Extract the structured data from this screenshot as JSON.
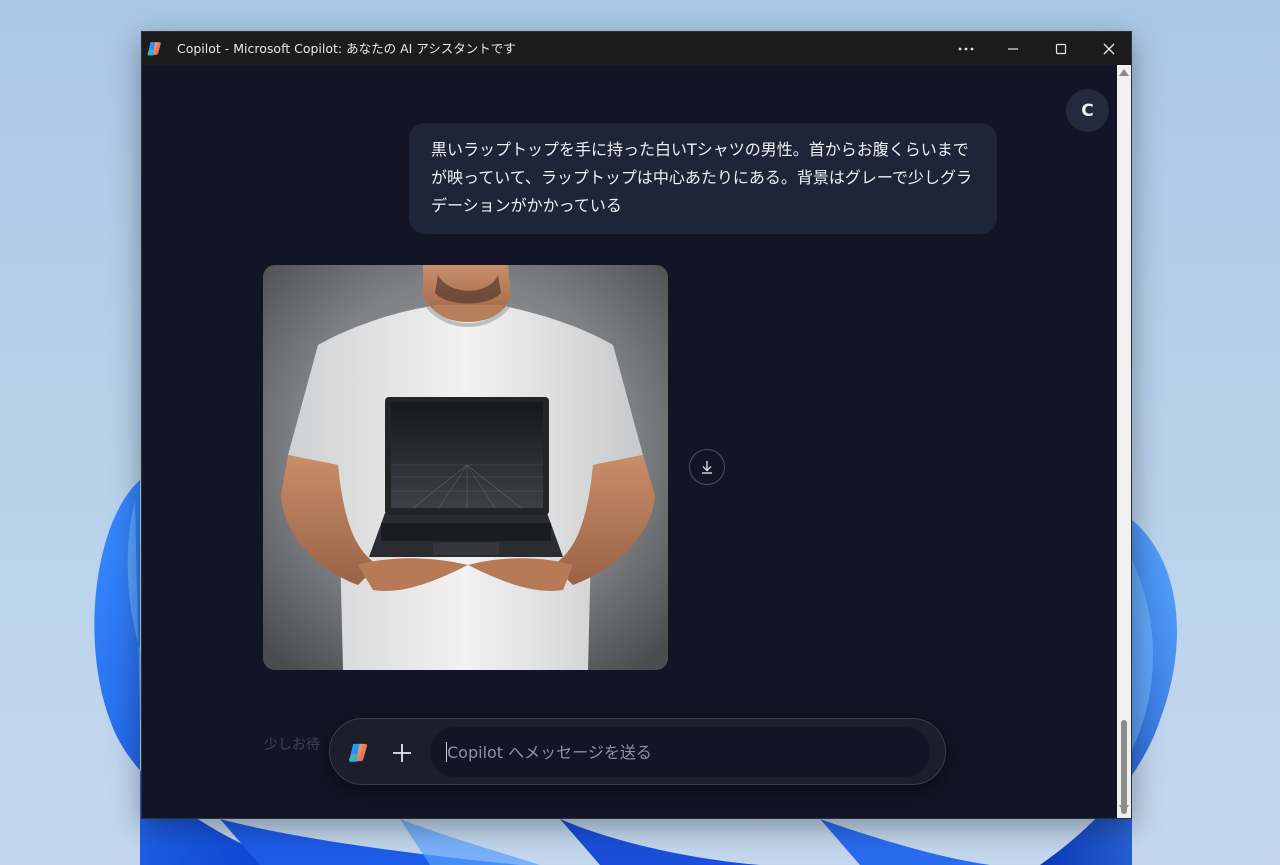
{
  "window": {
    "title": "Copilot - Microsoft Copilot: あなたの AI アシスタントです",
    "app_icon": "copilot-logo-icon",
    "controls": [
      "more-icon",
      "minimize-icon",
      "maximize-icon",
      "close-icon"
    ]
  },
  "chat": {
    "avatar_letter": "C",
    "user_message": "黒いラップトップを手に持った白いTシャツの男性。首からお腹くらいまでが映っていて、ラップトップは中心あたりにある。背景はグレーで少しグラデーションがかかっている",
    "generated_image": "man-holding-laptop-image",
    "download_icon": "download-icon",
    "faded_status": "少しお待"
  },
  "composer": {
    "logo_icon": "copilot-logo-icon",
    "add_icon": "plus-icon",
    "placeholder": "Copilot へメッセージを送る",
    "value": ""
  },
  "colors": {
    "window_bg": "#111526",
    "bubble_bg": "#1f2538",
    "titlebar_bg": "#1c1c1c"
  }
}
